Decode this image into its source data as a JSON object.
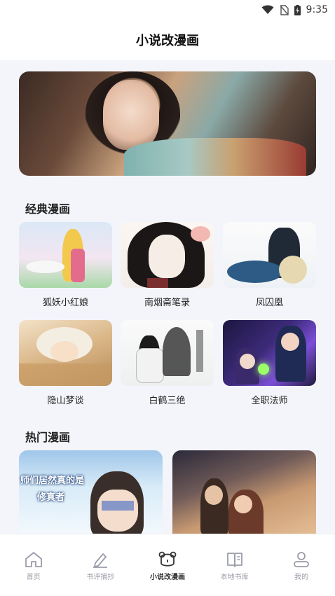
{
  "status_bar": {
    "time": "9:35"
  },
  "header": {
    "title": "小说改漫画"
  },
  "sections": {
    "classic_title": "经典漫画",
    "hot_title": "热门漫画"
  },
  "classic_comics": [
    {
      "title": "狐妖小红娘"
    },
    {
      "title": "南烟斋笔录"
    },
    {
      "title": "凤囚凰"
    },
    {
      "title": "隐山梦谈"
    },
    {
      "title": "白鹤三绝"
    },
    {
      "title": "全职法师"
    }
  ],
  "hot_comics": [
    {
      "overlay_line1": "师们居然真的是",
      "overlay_line2": "修真者"
    },
    {
      "overlay_line1": ""
    }
  ],
  "tabs": [
    {
      "label": "首页",
      "icon": "home-icon"
    },
    {
      "label": "书评摘抄",
      "icon": "pen-icon"
    },
    {
      "label": "小说改漫画",
      "icon": "bear-icon",
      "active": true
    },
    {
      "label": "本地书库",
      "icon": "book-icon"
    },
    {
      "label": "我的",
      "icon": "user-icon"
    }
  ],
  "colors": {
    "background": "#f4f5fa",
    "active_tab": "#333333",
    "inactive_tab": "#9a9ca8"
  }
}
